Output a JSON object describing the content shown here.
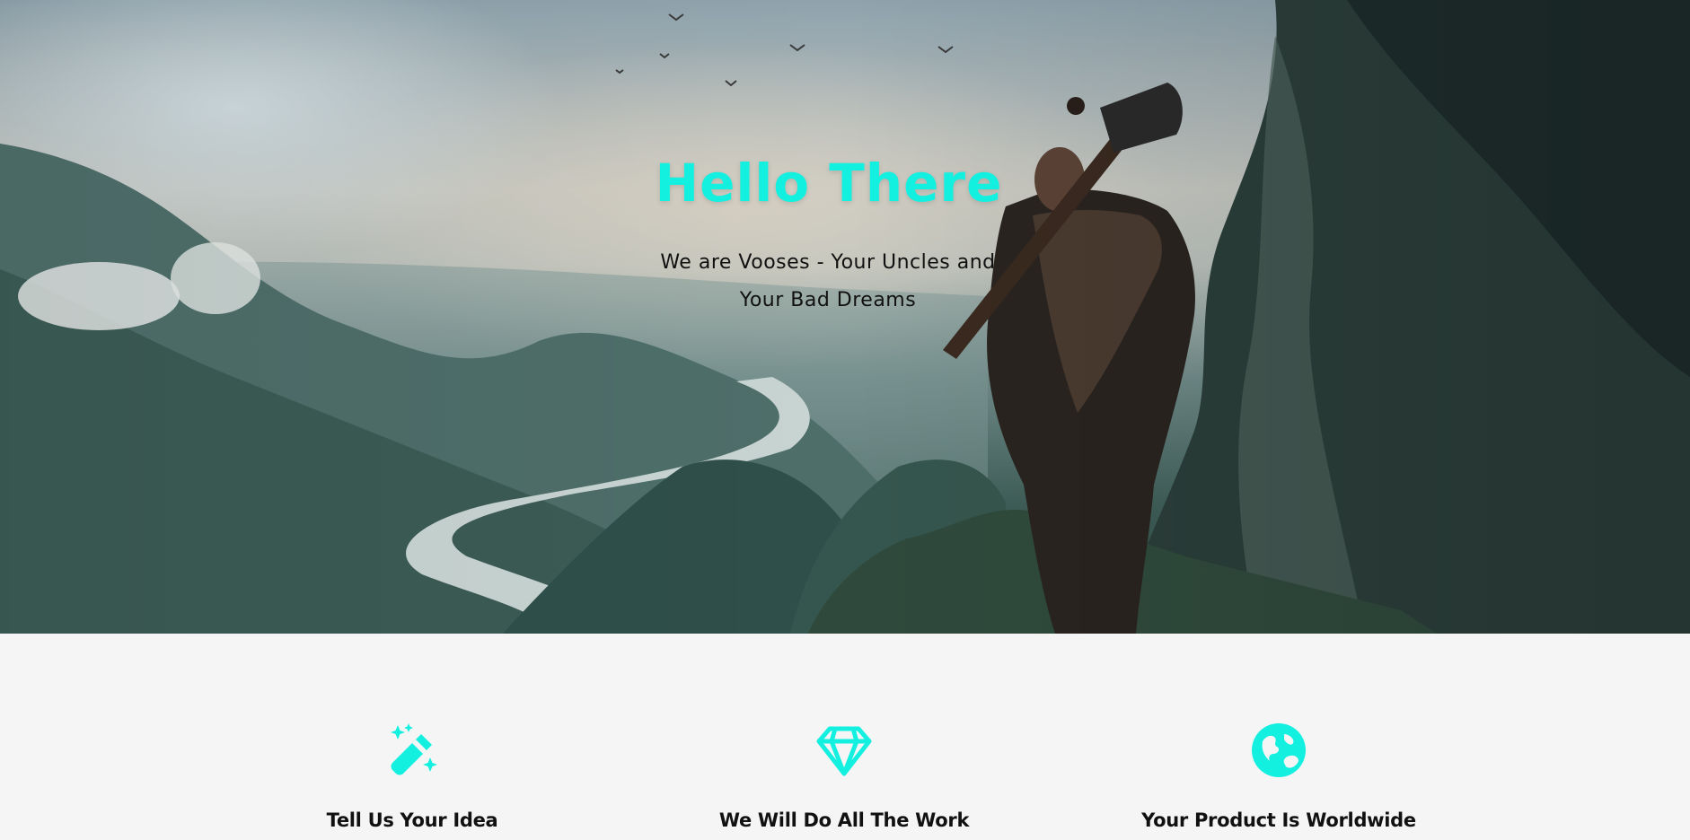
{
  "hero": {
    "title": "Hello There",
    "subtitle": "We are Vooses - Your Uncles and Your Bad Dreams"
  },
  "features": [
    {
      "icon": "magic-wand-icon",
      "title": "Tell Us Your Idea"
    },
    {
      "icon": "diamond-icon",
      "title": "We Will Do All The Work"
    },
    {
      "icon": "globe-icon",
      "title": "Your Product Is Worldwide"
    }
  ],
  "colors": {
    "accent": "#14f0e0",
    "text": "#111111",
    "section_bg": "#f5f5f5"
  }
}
